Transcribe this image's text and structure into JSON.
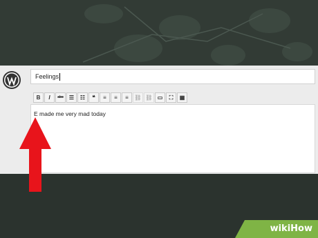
{
  "post": {
    "title_value": "Feelings",
    "content_text": "E made me very mad today"
  },
  "toolbar": {
    "buttons": [
      {
        "name": "bold-icon",
        "glyph": "B"
      },
      {
        "name": "italic-icon",
        "glyph": "I"
      },
      {
        "name": "strikethrough-icon",
        "glyph": "abc"
      },
      {
        "name": "bullet-list-icon",
        "glyph": "☰"
      },
      {
        "name": "numbered-list-icon",
        "glyph": "☷"
      },
      {
        "name": "blockquote-icon",
        "glyph": "❝"
      },
      {
        "name": "align-left-icon",
        "glyph": "≡"
      },
      {
        "name": "align-center-icon",
        "glyph": "≡"
      },
      {
        "name": "align-right-icon",
        "glyph": "≡"
      },
      {
        "name": "link-icon",
        "glyph": "⛓"
      },
      {
        "name": "unlink-icon",
        "glyph": "⛓"
      },
      {
        "name": "more-tag-icon",
        "glyph": "▭"
      },
      {
        "name": "fullscreen-icon",
        "glyph": "⛶"
      },
      {
        "name": "kitchen-sink-icon",
        "glyph": "▦"
      }
    ]
  },
  "watermark": {
    "brand_wiki": "wiki",
    "brand_how": "How"
  },
  "colors": {
    "arrow": "#e8141b",
    "panel": "#ececec",
    "background": "#2e3631"
  }
}
